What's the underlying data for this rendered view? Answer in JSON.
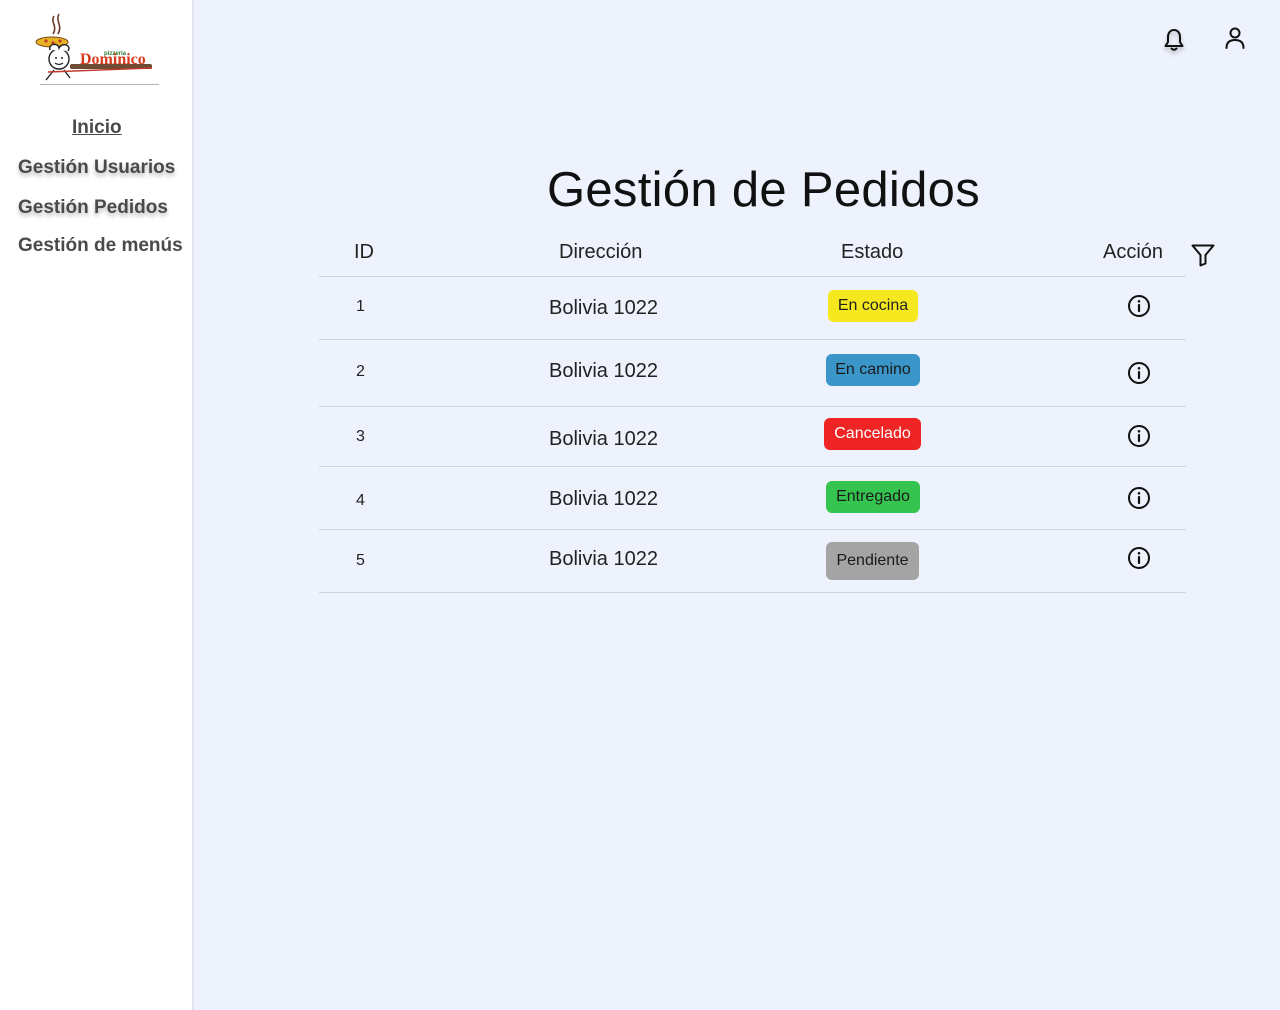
{
  "brand": {
    "logo_small_text": "pizzeria",
    "logo_main_text": "Dominico"
  },
  "sidebar": {
    "items": [
      {
        "label": "Inicio"
      },
      {
        "label": "Gestión Usuarios"
      },
      {
        "label": "Gestión Pedidos"
      },
      {
        "label": "Gestión de menús"
      }
    ]
  },
  "icons": {
    "notifications": "bell-icon",
    "profile": "user-icon",
    "filter": "filter-icon",
    "info": "info-icon"
  },
  "page": {
    "title": "Gestión de Pedidos"
  },
  "table": {
    "headers": {
      "id": "ID",
      "address": "Dirección",
      "status": "Estado",
      "action": "Acción"
    },
    "rows": [
      {
        "id": "1",
        "address": "Bolivia 1022",
        "status": "En cocina"
      },
      {
        "id": "2",
        "address": "Bolivia 1022",
        "status": "En camino"
      },
      {
        "id": "3",
        "address": "Bolivia 1022",
        "status": "Cancelado"
      },
      {
        "id": "4",
        "address": "Bolivia 1022",
        "status": "Entregado"
      },
      {
        "id": "5",
        "address": "Bolivia 1022",
        "status": "Pendiente"
      }
    ]
  },
  "colors": {
    "background": "#eef2fc",
    "status_en_cocina": "#f5e81e",
    "status_en_camino": "#3a96c8",
    "status_cancelado": "#ef2424",
    "status_entregado": "#35c44f",
    "status_pendiente": "#a3a4a3"
  }
}
